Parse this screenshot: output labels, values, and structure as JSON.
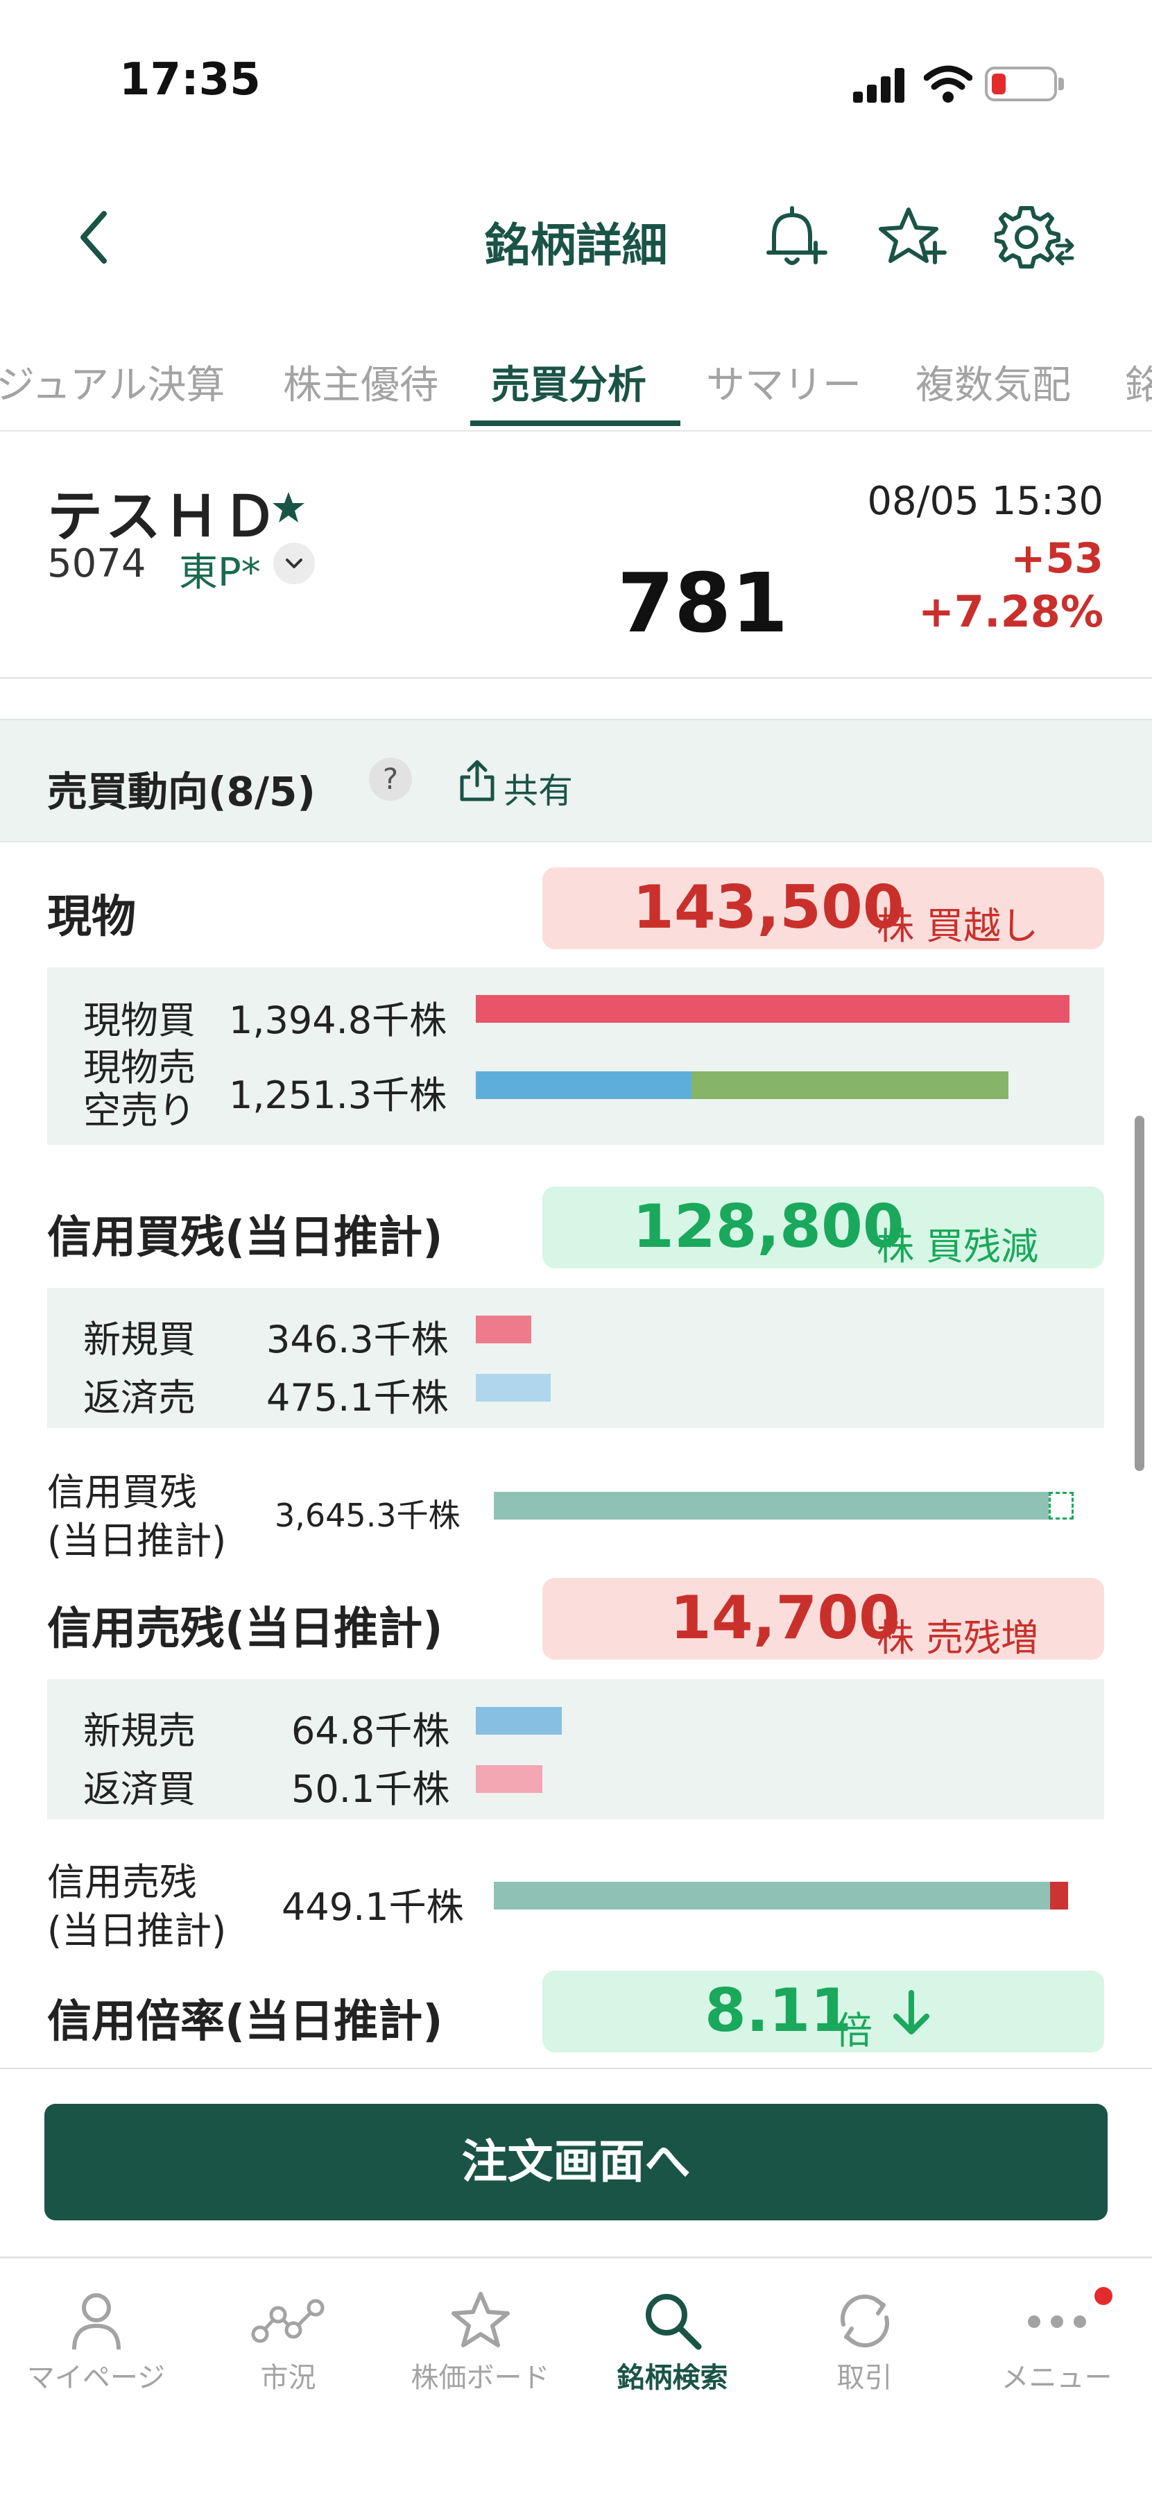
{
  "status_bar": {
    "time": "17:35"
  },
  "header": {
    "title": "銘柄詳細"
  },
  "tabs": [
    {
      "label": "ジュアル決算"
    },
    {
      "label": "株主優待"
    },
    {
      "label": "売買分析"
    },
    {
      "label": "サマリー"
    },
    {
      "label": "複数気配"
    },
    {
      "label": "銘"
    }
  ],
  "stock": {
    "name": "テスＨＤ",
    "code": "5074",
    "market": "東P*",
    "price": "781",
    "datetime": "08/05 15:30",
    "change": "+53",
    "change_pct": "+7.28%"
  },
  "section": {
    "title": "売買動向(8/5)",
    "help": "?",
    "share": "共有"
  },
  "genbutsu": {
    "label": "現物",
    "summary_value": "143,500",
    "summary_unit": "株 買越し",
    "buy_label": "現物買",
    "buy_value": "1,394.8千株",
    "sell_label1": "現物売",
    "sell_label2": "空売り",
    "sell_value": "1,251.3千株",
    "bars": {
      "buy": 1394.8,
      "sell_spot": 506,
      "sell_short": 745.3,
      "max": 1394.8
    }
  },
  "credit_buy": {
    "label": "信用買残(当日推計)",
    "summary_value": "128,800",
    "summary_unit": "株 買残減",
    "new_label": "新規買",
    "new_value": "346.3千株",
    "repay_label": "返済売",
    "repay_value": "475.1千株",
    "total_label1": "信用買残",
    "total_label2": "(当日推計)",
    "total_value": "3,645.3千株"
  },
  "credit_sell": {
    "label": "信用売残(当日推計)",
    "summary_value": "14,700",
    "summary_unit": "株 売残増",
    "new_label": "新規売",
    "new_value": "64.8千株",
    "repay_label": "返済買",
    "repay_value": "50.1千株",
    "total_label1": "信用売残",
    "total_label2": "(当日推計)",
    "total_value": "449.1千株"
  },
  "credit_ratio": {
    "label": "信用倍率(当日推計)",
    "value": "8.11",
    "unit": "倍"
  },
  "order_button": {
    "label": "注文画面へ"
  },
  "bottom_nav": [
    {
      "label": "マイページ",
      "icon": "person-icon"
    },
    {
      "label": "市況",
      "icon": "market-chart-icon"
    },
    {
      "label": "株価ボード",
      "icon": "star-board-icon"
    },
    {
      "label": "銘柄検索",
      "icon": "search-icon"
    },
    {
      "label": "取引",
      "icon": "refresh-trade-icon"
    },
    {
      "label": "メニュー",
      "icon": "more-icon"
    }
  ],
  "colors": {
    "brand": "#1a5446",
    "up_red": "#c9302c",
    "down_green": "#19a85c",
    "bar_buy": "#e95468",
    "bar_spot_sell": "#5eaedb",
    "bar_short": "#86b56a"
  }
}
